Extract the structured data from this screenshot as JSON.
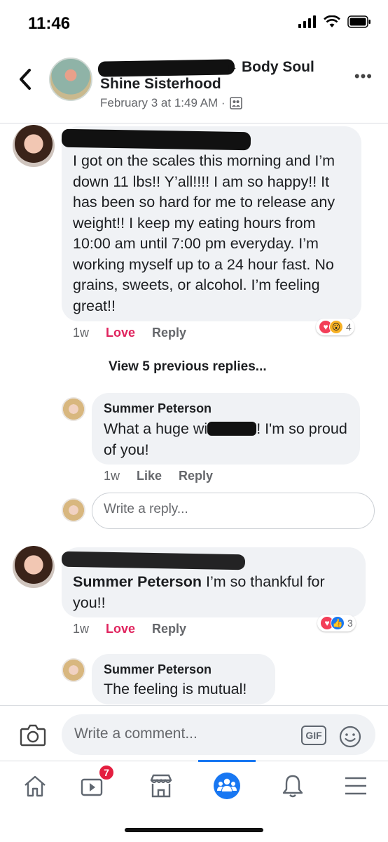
{
  "status_bar": {
    "time": "11:46"
  },
  "post_header": {
    "group_name_part1": "Body Soul",
    "group_name_part2": "Shine Sisterhood",
    "date": "February 3 at 1:49 AM ·"
  },
  "comments": [
    {
      "text": "I got on the scales this morning and I’m down 11 lbs!! Y’all!!!! I am so happy!! It has been so hard for me to release any weight!! I keep my eating hours from 10:00 am until 7:00 pm everyday. I’m working myself up to a 24 hour fast. No grains, sweets, or alcohol. I’m feeling great!!",
      "time": "1w",
      "reaction_label": "Love",
      "reply_label": "Reply",
      "reaction_count": "4"
    }
  ],
  "view_previous": "View 5 previous replies...",
  "replies": [
    {
      "author": "Summer Peterson",
      "text_before": "What a huge wi",
      "text_after": "! I'm so proud of you!",
      "time": "1w",
      "like_label": "Like",
      "reply_label": "Reply"
    }
  ],
  "reply_input": {
    "placeholder": "Write a reply..."
  },
  "comment2": {
    "author_mention": "Summer Peterson",
    "text": " I’m so thankful for you!!",
    "time": "1w",
    "reaction_label": "Love",
    "reply_label": "Reply",
    "reaction_count": "3"
  },
  "reply2": {
    "author": "Summer Peterson",
    "text": "The feeling is mutual!"
  },
  "comment_bar": {
    "placeholder": "Write a comment...",
    "gif_label": "GIF"
  },
  "tab_bar": {
    "video_badge": "7"
  },
  "colors": {
    "accent": "#1877f2",
    "love": "#e0245e",
    "badge": "#e41e3f"
  }
}
